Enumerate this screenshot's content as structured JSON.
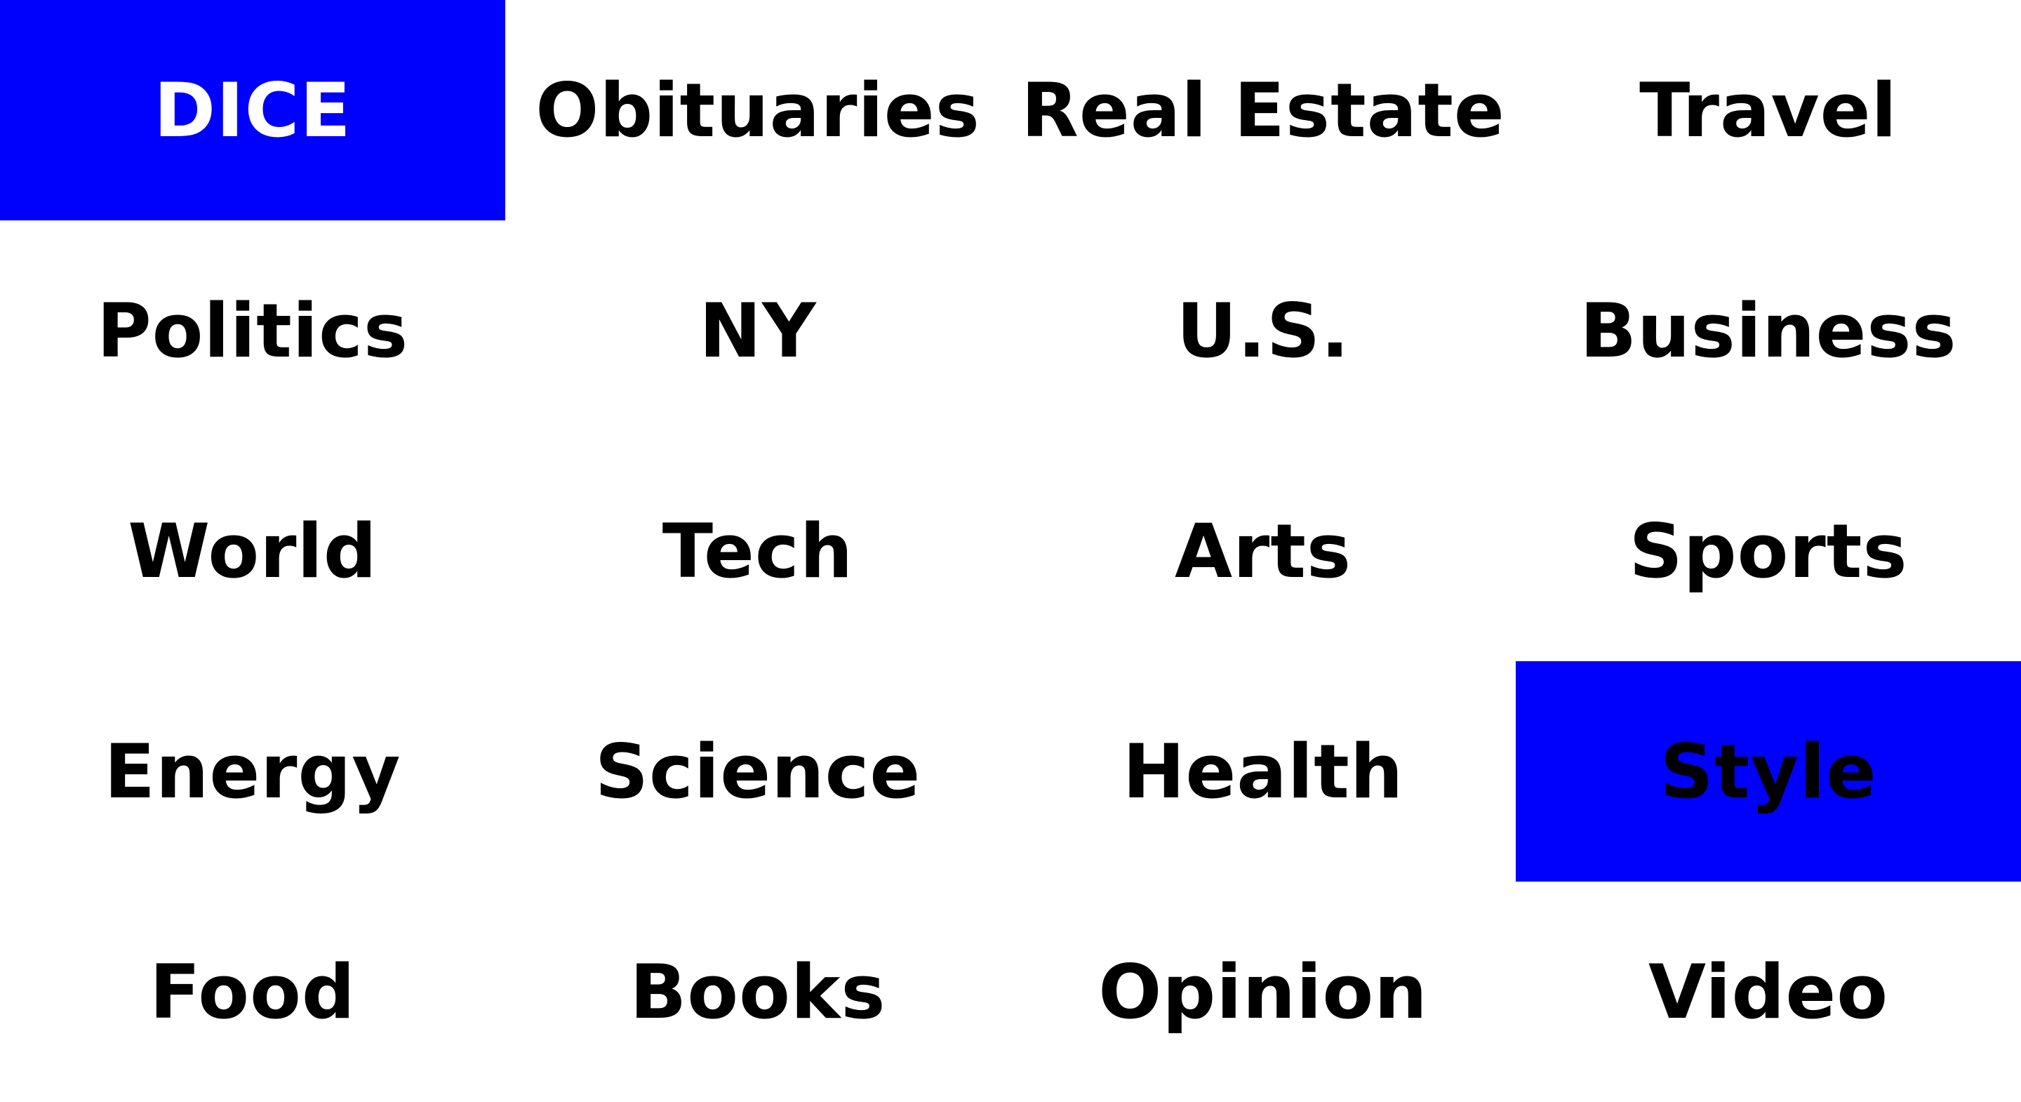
{
  "colors": {
    "background": "#ffffff",
    "highlight": "#0000fd",
    "text": "#000000",
    "highlight_text_primary": "#ffffff",
    "highlight_text_secondary": "#000000"
  },
  "sections": {
    "dice": "DICE",
    "obituaries": "Obituaries",
    "real_estate": "Real Estate",
    "travel": "Travel",
    "politics": "Politics",
    "ny": "NY",
    "us": "U.S.",
    "business": "Business",
    "world": "World",
    "tech": "Tech",
    "arts": "Arts",
    "sports": "Sports",
    "energy": "Energy",
    "science": "Science",
    "health": "Health",
    "style": "Style",
    "food": "Food",
    "books": "Books",
    "opinion": "Opinion",
    "video": "Video"
  },
  "highlighted": [
    "dice",
    "style"
  ]
}
